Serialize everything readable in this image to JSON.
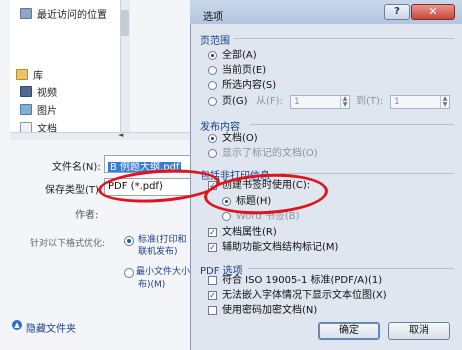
{
  "save_dialog": {
    "nav": {
      "recent": "最近访问的位置",
      "library": "库",
      "videos": "视频",
      "pictures": "图片",
      "documents": "文档"
    },
    "filename_label": "文件名(N):",
    "filename_value": "B 例题大纲.pdf",
    "save_type_label": "保存类型(T):",
    "save_type_value": "PDF (*.pdf)",
    "authors_label": "作者:",
    "optimize_label": "针对以下格式优化:",
    "optimize_standard": "标准(打印和联机发布)(A)",
    "optimize_min_line1": "最小文件大小(联机发",
    "optimize_min_line2": "布)(M)",
    "hide_folders": "隐藏文件夹"
  },
  "options_dialog": {
    "title": "选项",
    "help_glyph": "?",
    "close_glyph": "✕",
    "page_range": {
      "title": "页范围",
      "all": "全部(A)",
      "current": "当前页(E)",
      "selection": "所选内容(S)",
      "pages": "页(G)",
      "from": "从(F):",
      "from_value": "1",
      "to": "到(T):",
      "to_value": "1"
    },
    "publish": {
      "title": "发布内容",
      "document": "文档(O)",
      "markup": "显示了标记的文档(O)"
    },
    "non_print": {
      "title": "包括非打印信息",
      "bookmarks": "创建书签时使用(C):",
      "headings": "标题(H)",
      "word_bookmarks": "Word 书签(B)",
      "properties": "文档属性(R)",
      "tags": "辅助功能文档结构标记(M)"
    },
    "pdf_options": {
      "title": "PDF 选项",
      "iso": "符合 ISO 19005-1 标准(PDF/A)(1)",
      "bitmap": "无法嵌入字体情况下显示文本位图(X)",
      "encrypt": "使用密码加密文档(N)"
    },
    "ok": "确定",
    "cancel": "取消"
  },
  "colors": {
    "annotation_red": "#e0141e",
    "selection_blue": "#3a7bd5"
  }
}
